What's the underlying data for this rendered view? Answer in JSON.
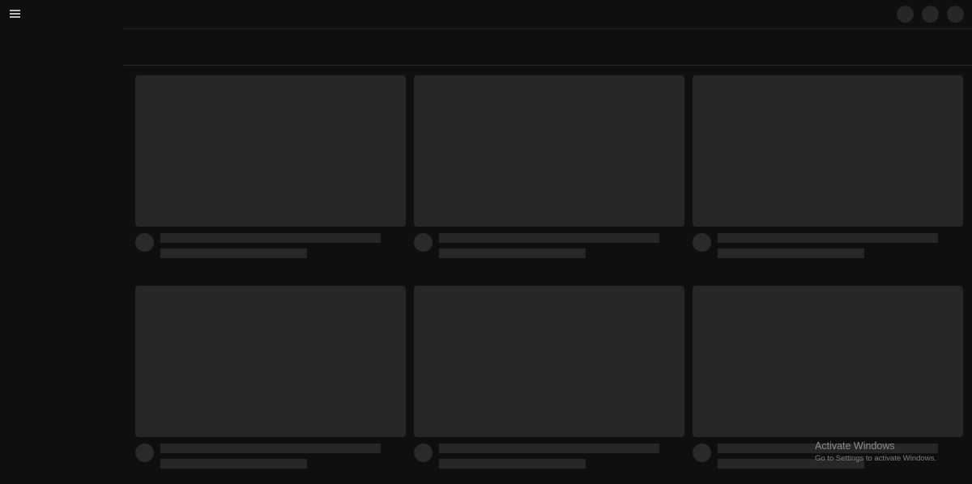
{
  "header": {
    "menu_icon": "hamburger-menu-icon",
    "action_icons": [
      "placeholder-circle-icon",
      "placeholder-circle-icon",
      "placeholder-circle-icon"
    ]
  },
  "grid": {
    "cards": [
      {
        "state": "loading"
      },
      {
        "state": "loading"
      },
      {
        "state": "loading"
      },
      {
        "state": "loading"
      },
      {
        "state": "loading"
      },
      {
        "state": "loading"
      }
    ]
  },
  "colors": {
    "background": "#0f0f0f",
    "skeleton": "#272727",
    "divider": "#262626"
  },
  "watermark": {
    "title": "Activate Windows",
    "subtitle": "Go to Settings to activate Windows."
  }
}
